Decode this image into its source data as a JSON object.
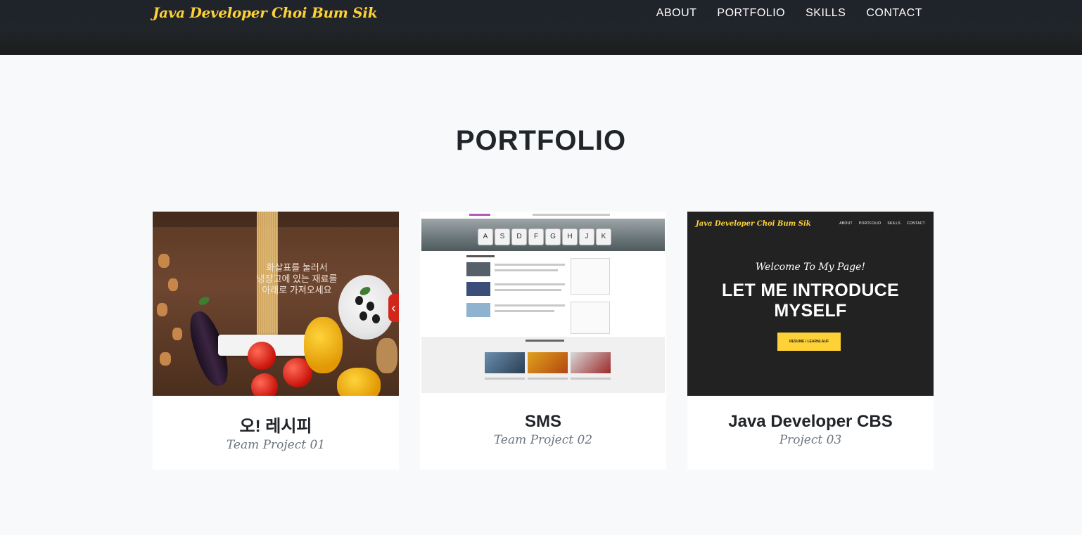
{
  "navbar": {
    "brand": "Java Developer Choi Bum Sik",
    "links": [
      "ABOUT",
      "PORTFOLIO",
      "SKILLS",
      "CONTACT"
    ]
  },
  "portfolio": {
    "heading": "PORTFOLIO",
    "items": [
      {
        "title": "오! 레시피",
        "subtitle": "Team Project 01",
        "thumb": {
          "hero_line1": "화살표를 눌러서",
          "hero_line2": "냉장고에 있는 재료를",
          "hero_line3": "아래로 가져오세요",
          "arrow": "‹"
        }
      },
      {
        "title": "SMS",
        "subtitle": "Team Project 02",
        "thumb": {
          "keys": [
            "A",
            "S",
            "D",
            "F",
            "G",
            "H",
            "J",
            "K"
          ]
        }
      },
      {
        "title": "Java Developer CBS",
        "subtitle": "Project 03",
        "thumb": {
          "brand": "Java Developer Choi Bum Sik",
          "nav": [
            "ABOUT",
            "PORTFOLIO",
            "SKILLS",
            "CONTACT"
          ],
          "welcome": "Welcome To My Page!",
          "intro_line1": "LET ME INTRODUCE",
          "intro_line2": "MYSELF",
          "cta": "RESUME / LEARNLAUF"
        }
      }
    ]
  },
  "colors": {
    "accent": "#fed136",
    "navbar_bg": "#212529",
    "page_bg": "#f8f9fa"
  }
}
